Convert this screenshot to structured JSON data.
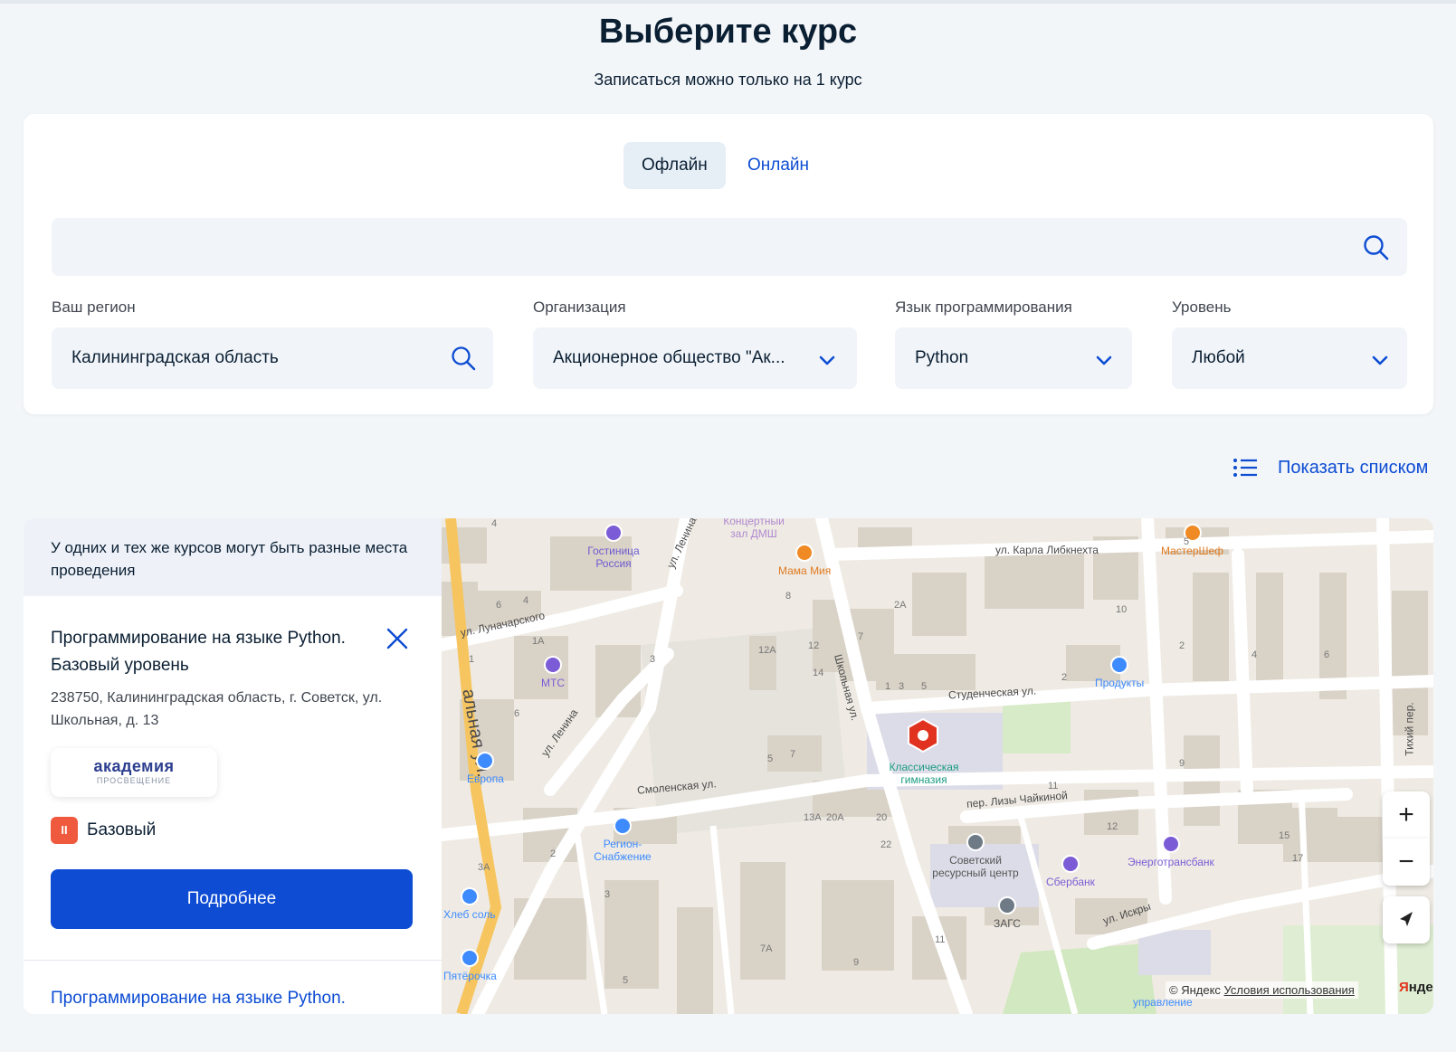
{
  "page": {
    "title": "Выберите курс",
    "subtitle": "Записаться можно только на 1 курс"
  },
  "tabs": [
    {
      "label": "Офлайн",
      "active": true
    },
    {
      "label": "Онлайн",
      "active": false
    }
  ],
  "search": {
    "value": "",
    "placeholder": ""
  },
  "filters": {
    "region": {
      "label": "Ваш регион",
      "value": "Калининградская область"
    },
    "organization": {
      "label": "Организация",
      "value": "Акционерное общество \"Ак..."
    },
    "language": {
      "label": "Язык программирования",
      "value": "Python"
    },
    "level": {
      "label": "Уровень",
      "value": "Любой"
    }
  },
  "view_toggle": {
    "label": "Показать списком"
  },
  "sidebar": {
    "notice": "У одних и тех же курсов могут быть разные места проведения",
    "card": {
      "title_line1": "Программирование на языке Python.",
      "title_line2": "Базовый уровень",
      "address": "238750, Калининградская область, г. Советск, ул. Школьная, д. 13",
      "org_logo_main": "академия",
      "org_logo_sub": "ПРОСВЕЩЕНИЕ",
      "level_badge": "II",
      "level_label": "Базовый",
      "details_button": "Подробнее"
    },
    "next_card_title": "Программирование на языке Python."
  },
  "map": {
    "streets": {
      "karla_libknekhta": "ул. Карла Либкнехта",
      "lunacharskogo": "ул. Луначарского",
      "lenina_1": "ул. Ленина",
      "lenina_2": "ул. Ленина",
      "shkolnaya": "Школьная ул.",
      "studencheskaya": "Студенческая ул.",
      "smolenskaya": "Смоленская ул.",
      "lizy_chaikinoi": "пер. Лизы Чайкиной",
      "iskry": "ул. Искры",
      "tikhiy": "Тихий пер.",
      "vokzalnaya": "альная ул."
    },
    "pois": {
      "gostinitsa": "Гостиница Россия",
      "koncertny": "Концертный зал ДМШ",
      "mama_mia": "Мама Мия",
      "mastershef": "МастерШеф",
      "mts": "МТС",
      "produkty": "Продукты",
      "evropa": "Европа",
      "gimnaziya": "Классическая гимназия",
      "region_snab": "Регион-Снабжение",
      "sovetsky_centr": "Советский ресурсный центр",
      "sberbank": "Сбербанк",
      "energotransbank": "Энерготрансбанк",
      "zags": "ЗАГС",
      "khleb_sol": "Хлеб соль",
      "pyaterochka": "Пятёрочка",
      "upravlenie": "управление"
    },
    "house_numbers": [
      "4",
      "6",
      "4",
      "3",
      "1",
      "1А",
      "6",
      "5",
      "7",
      "12А",
      "12",
      "14",
      "8",
      "7",
      "2А",
      "1",
      "3",
      "5",
      "10",
      "2",
      "2",
      "4",
      "6",
      "9",
      "11",
      "13А",
      "20А",
      "20",
      "22",
      "12",
      "15",
      "17",
      "7А",
      "9",
      "11",
      "3",
      "5",
      "2",
      "3А",
      "5"
    ],
    "controls": {
      "zoom_in": "+",
      "zoom_out": "−"
    },
    "copyright_prefix": "© Яндекс",
    "terms_link": "Условия использования",
    "brand_first": "Я",
    "brand_rest": "ндекс",
    "colors": {
      "marker": "#e0321e",
      "poi_blue": "#3d8bff",
      "poi_purple": "#7b5cd6",
      "poi_orange": "#f08a24",
      "poi_gray": "#6e7a86"
    }
  },
  "colors": {
    "accent": "#0d4cd3",
    "level_badge": "#ef5a3f",
    "background": "#f3f6f9"
  }
}
